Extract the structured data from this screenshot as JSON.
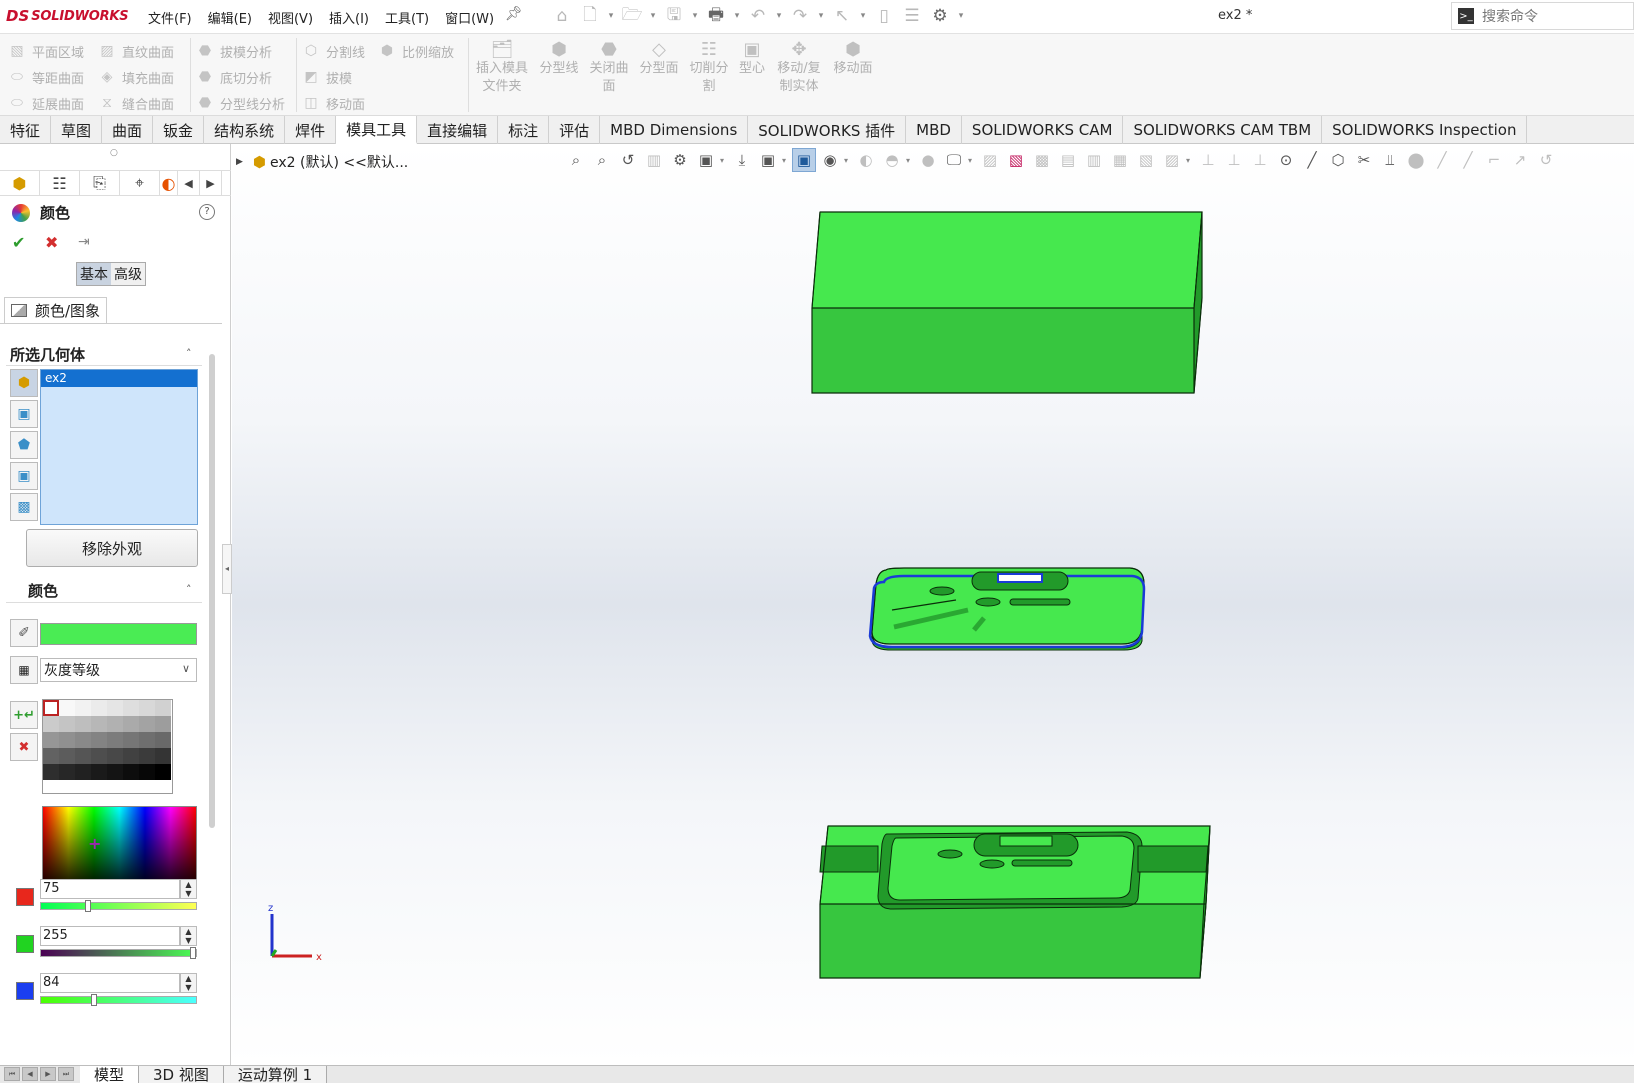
{
  "app": {
    "logo_ds": "DS",
    "logo_name": "SOLIDWORKS",
    "document_title": "ex2 *",
    "search_placeholder": "搜索命令"
  },
  "menu": [
    "文件(F)",
    "编辑(E)",
    "视图(V)",
    "插入(I)",
    "工具(T)",
    "窗口(W)"
  ],
  "command_manager": {
    "small_columns": [
      [
        "平面区域",
        "等距曲面",
        "延展曲面"
      ],
      [
        "直纹曲面",
        "填充曲面",
        "缝合曲面"
      ],
      [
        "拔模分析",
        "底切分析",
        "分型线分析"
      ],
      [
        "分割线",
        "拔模",
        "移动面"
      ],
      [
        "比例缩放"
      ]
    ],
    "big_buttons": [
      [
        "插入模具",
        "文件夹"
      ],
      [
        "分型线"
      ],
      [
        "关闭曲",
        "面"
      ],
      [
        "分型面"
      ],
      [
        "切削分",
        "割"
      ],
      [
        "型心"
      ],
      [
        "移动/复",
        "制实体"
      ],
      [
        "移动面"
      ]
    ]
  },
  "tabs": [
    "特征",
    "草图",
    "曲面",
    "钣金",
    "结构系统",
    "焊件",
    "模具工具",
    "直接编辑",
    "标注",
    "评估",
    "MBD Dimensions",
    "SOLIDWORKS 插件",
    "MBD",
    "SOLIDWORKS CAM",
    "SOLIDWORKS CAM TBM",
    "SOLIDWORKS Inspection"
  ],
  "active_tab": "模具工具",
  "property_manager": {
    "title": "颜色",
    "mode_basic": "基本",
    "mode_advanced": "高级",
    "subtab": "颜色/图象",
    "selected_geometry_heading": "所选几何体",
    "selected_items": [
      "ex2"
    ],
    "remove_appearance_button": "移除外观",
    "color_heading": "颜色",
    "current_color": "#4aec54",
    "palette_name": "灰度等级",
    "rgb": {
      "red": "75",
      "green": "255",
      "blue": "84"
    }
  },
  "viewport": {
    "breadcrumb": "ex2 (默认) <<默认..."
  },
  "colors": {
    "part_face": "#46e84e",
    "part_side": "#37c63f",
    "part_dark": "#229a2a",
    "edge": "#0a2e0a",
    "selection": "#1a3bd6",
    "red_swatch": "#e8271c",
    "green_swatch": "#21d321",
    "blue_swatch": "#1b3ef0"
  },
  "axis_labels": {
    "x": "x",
    "z": "z"
  },
  "bottom_tabs": [
    "模型",
    "3D 视图",
    "运动算例 1"
  ]
}
